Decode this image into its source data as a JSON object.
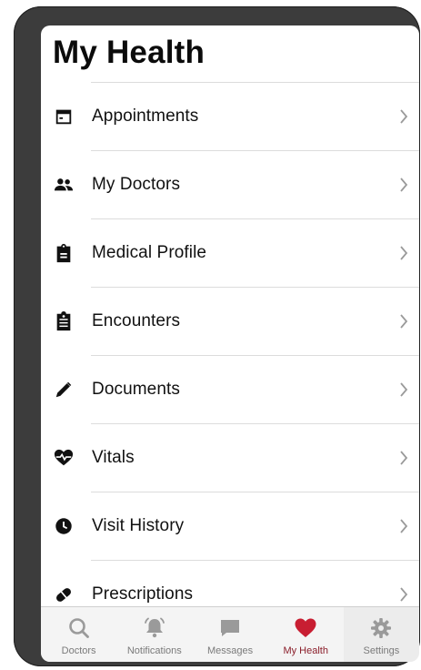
{
  "page": {
    "title": "My Health"
  },
  "menu": [
    {
      "label": "Appointments",
      "icon": "calendar-icon"
    },
    {
      "label": "My Doctors",
      "icon": "people-icon"
    },
    {
      "label": "Medical Profile",
      "icon": "clipboard-icon"
    },
    {
      "label": "Encounters",
      "icon": "medical-clipboard-icon"
    },
    {
      "label": "Documents",
      "icon": "pencil-icon"
    },
    {
      "label": "Vitals",
      "icon": "heart-pulse-icon"
    },
    {
      "label": "Visit History",
      "icon": "clock-icon"
    },
    {
      "label": "Prescriptions",
      "icon": "pill-icon"
    }
  ],
  "tabs": [
    {
      "label": "Doctors",
      "icon": "search-icon",
      "active": false
    },
    {
      "label": "Notifications",
      "icon": "bell-icon",
      "active": false
    },
    {
      "label": "Messages",
      "icon": "chat-icon",
      "active": false
    },
    {
      "label": "My Health",
      "icon": "heart-icon",
      "active": true
    },
    {
      "label": "Settings",
      "icon": "gear-icon",
      "active": false
    }
  ],
  "colors": {
    "active_tab": "#c81e32",
    "active_tab_label": "#8a1e2a",
    "inactive_icon": "#9a9a9a"
  }
}
